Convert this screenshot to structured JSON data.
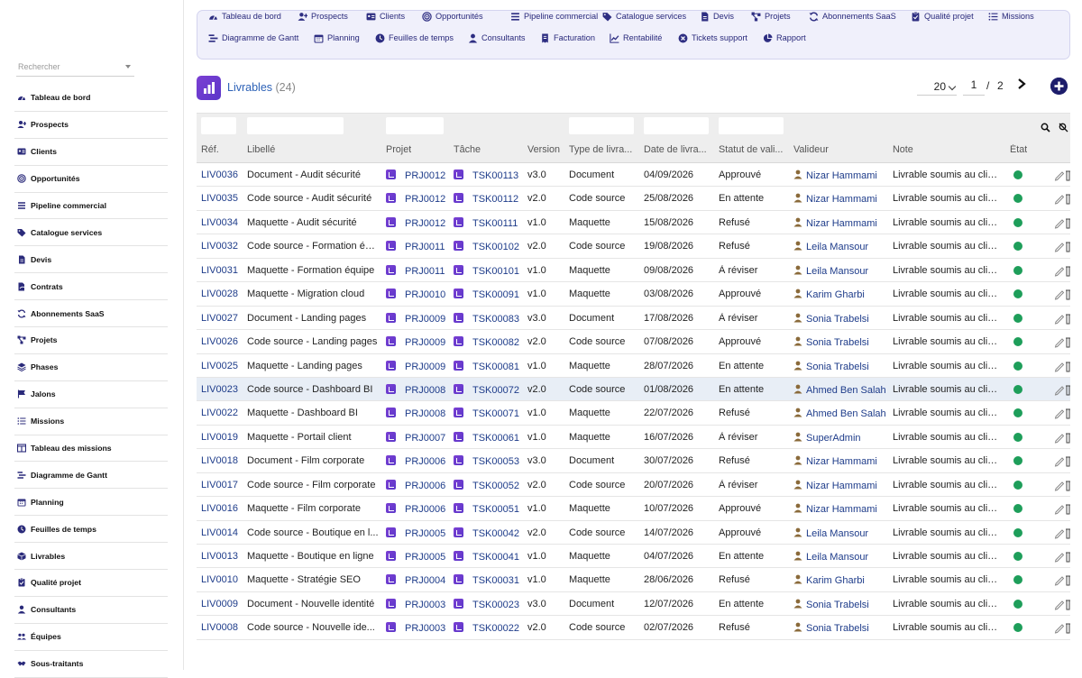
{
  "sidebar": {
    "search_placeholder": "Rechercher",
    "items": [
      {
        "label": "Tableau de bord",
        "icon": "dashboard-icon"
      },
      {
        "label": "Prospects",
        "icon": "user-plus-icon"
      },
      {
        "label": "Clients",
        "icon": "id-card-icon"
      },
      {
        "label": "Opportunités",
        "icon": "target-icon"
      },
      {
        "label": "Pipeline commercial",
        "icon": "bars-icon"
      },
      {
        "label": "Catalogue services",
        "icon": "tags-icon"
      },
      {
        "label": "Devis",
        "icon": "file-icon"
      },
      {
        "label": "Contrats",
        "icon": "file-signature-icon"
      },
      {
        "label": "Abonnements SaaS",
        "icon": "sync-icon"
      },
      {
        "label": "Projets",
        "icon": "project-diagram-icon"
      },
      {
        "label": "Phases",
        "icon": "layers-icon"
      },
      {
        "label": "Jalons",
        "icon": "flag-icon"
      },
      {
        "label": "Missions",
        "icon": "list-icon"
      },
      {
        "label": "Tableau des missions",
        "icon": "columns-icon"
      },
      {
        "label": "Diagramme de Gantt",
        "icon": "gantt-icon"
      },
      {
        "label": "Planning",
        "icon": "calendar-icon"
      },
      {
        "label": "Feuilles de temps",
        "icon": "clock-icon"
      },
      {
        "label": "Livrables",
        "icon": "box-icon"
      },
      {
        "label": "Qualité projet",
        "icon": "clipboard-check-icon"
      },
      {
        "label": "Consultants",
        "icon": "user-icon"
      },
      {
        "label": "Équipes",
        "icon": "users-icon"
      },
      {
        "label": "Sous-traitants",
        "icon": "handshake-icon"
      }
    ]
  },
  "topnav": {
    "row1": [
      {
        "label": "Tableau de bord",
        "icon": "dashboard-icon"
      },
      {
        "label": "Prospects",
        "icon": "user-plus-icon"
      },
      {
        "label": "Clients",
        "icon": "id-card-icon"
      },
      {
        "label": "Opportunités",
        "icon": "target-icon"
      },
      {
        "label": "Pipeline commercial",
        "icon": "bars-icon"
      },
      {
        "label": "Catalogue services",
        "icon": "tags-icon"
      },
      {
        "label": "Devis",
        "icon": "file-icon"
      },
      {
        "label": "Projets",
        "icon": "project-diagram-icon"
      },
      {
        "label": "Abonnements SaaS",
        "icon": "sync-icon"
      },
      {
        "label": "Qualité projet",
        "icon": "clipboard-check-icon"
      },
      {
        "label": "Missions",
        "icon": "list-icon"
      }
    ],
    "row2": [
      {
        "label": "Diagramme de Gantt",
        "icon": "gantt-icon"
      },
      {
        "label": "Planning",
        "icon": "calendar-icon"
      },
      {
        "label": "Feuilles de temps",
        "icon": "clock-icon"
      },
      {
        "label": "Consultants",
        "icon": "user-icon"
      },
      {
        "label": "Facturation",
        "icon": "invoice-icon"
      },
      {
        "label": "Rentabilité",
        "icon": "chart-line-icon"
      },
      {
        "label": "Tickets support",
        "icon": "ticket-icon"
      },
      {
        "label": "Rapport",
        "icon": "pie-chart-icon"
      }
    ]
  },
  "page": {
    "title": "Livrables",
    "count": "(24)",
    "page_size": "20",
    "current_page": "1",
    "separator": "/",
    "total_pages": "2"
  },
  "table": {
    "headers": [
      "Réf.",
      "Libellé",
      "Projet",
      "Tâche",
      "Version",
      "Type de livra...",
      "Date de livra...",
      "Statut de vali...",
      "Valideur",
      "Note",
      "État"
    ],
    "rows": [
      [
        "LIV0036",
        "Document - Audit sécurité",
        "PRJ0012",
        "TSK00113",
        "v3.0",
        "Document",
        "04/09/2026",
        "Approuvé",
        "Nizar Hammami",
        "Livrable soumis au client."
      ],
      [
        "LIV0035",
        "Code source - Audit sécurité",
        "PRJ0012",
        "TSK00112",
        "v2.0",
        "Code source",
        "25/08/2026",
        "En attente",
        "Nizar Hammami",
        "Livrable soumis au client."
      ],
      [
        "LIV0034",
        "Maquette - Audit sécurité",
        "PRJ0012",
        "TSK00111",
        "v1.0",
        "Maquette",
        "15/08/2026",
        "Refusé",
        "Nizar Hammami",
        "Livrable soumis au client."
      ],
      [
        "LIV0032",
        "Code source - Formation équ...",
        "PRJ0011",
        "TSK00102",
        "v2.0",
        "Code source",
        "19/08/2026",
        "Refusé",
        "Leila Mansour",
        "Livrable soumis au client."
      ],
      [
        "LIV0031",
        "Maquette - Formation équipe",
        "PRJ0011",
        "TSK00101",
        "v1.0",
        "Maquette",
        "09/08/2026",
        "À réviser",
        "Leila Mansour",
        "Livrable soumis au client."
      ],
      [
        "LIV0028",
        "Maquette - Migration cloud",
        "PRJ0010",
        "TSK00091",
        "v1.0",
        "Maquette",
        "03/08/2026",
        "Approuvé",
        "Karim Gharbi",
        "Livrable soumis au client."
      ],
      [
        "LIV0027",
        "Document - Landing pages",
        "PRJ0009",
        "TSK00083",
        "v3.0",
        "Document",
        "17/08/2026",
        "À réviser",
        "Sonia Trabelsi",
        "Livrable soumis au client."
      ],
      [
        "LIV0026",
        "Code source - Landing pages",
        "PRJ0009",
        "TSK00082",
        "v2.0",
        "Code source",
        "07/08/2026",
        "Approuvé",
        "Sonia Trabelsi",
        "Livrable soumis au client."
      ],
      [
        "LIV0025",
        "Maquette - Landing pages",
        "PRJ0009",
        "TSK00081",
        "v1.0",
        "Maquette",
        "28/07/2026",
        "En attente",
        "Sonia Trabelsi",
        "Livrable soumis au client."
      ],
      [
        "LIV0023",
        "Code source - Dashboard BI",
        "PRJ0008",
        "TSK00072",
        "v2.0",
        "Code source",
        "01/08/2026",
        "En attente",
        "Ahmed Ben Salah",
        "Livrable soumis au client."
      ],
      [
        "LIV0022",
        "Maquette - Dashboard BI",
        "PRJ0008",
        "TSK00071",
        "v1.0",
        "Maquette",
        "22/07/2026",
        "Refusé",
        "Ahmed Ben Salah",
        "Livrable soumis au client."
      ],
      [
        "LIV0019",
        "Maquette - Portail client",
        "PRJ0007",
        "TSK00061",
        "v1.0",
        "Maquette",
        "16/07/2026",
        "À réviser",
        "SuperAdmin",
        "Livrable soumis au client."
      ],
      [
        "LIV0018",
        "Document - Film corporate",
        "PRJ0006",
        "TSK00053",
        "v3.0",
        "Document",
        "30/07/2026",
        "Refusé",
        "Nizar Hammami",
        "Livrable soumis au client."
      ],
      [
        "LIV0017",
        "Code source - Film corporate",
        "PRJ0006",
        "TSK00052",
        "v2.0",
        "Code source",
        "20/07/2026",
        "À réviser",
        "Nizar Hammami",
        "Livrable soumis au client."
      ],
      [
        "LIV0016",
        "Maquette - Film corporate",
        "PRJ0006",
        "TSK00051",
        "v1.0",
        "Maquette",
        "10/07/2026",
        "Approuvé",
        "Nizar Hammami",
        "Livrable soumis au client."
      ],
      [
        "LIV0014",
        "Code source - Boutique en l...",
        "PRJ0005",
        "TSK00042",
        "v2.0",
        "Code source",
        "14/07/2026",
        "Approuvé",
        "Leila Mansour",
        "Livrable soumis au client."
      ],
      [
        "LIV0013",
        "Maquette - Boutique en ligne",
        "PRJ0005",
        "TSK00041",
        "v1.0",
        "Maquette",
        "04/07/2026",
        "En attente",
        "Leila Mansour",
        "Livrable soumis au client."
      ],
      [
        "LIV0010",
        "Maquette - Stratégie SEO",
        "PRJ0004",
        "TSK00031",
        "v1.0",
        "Maquette",
        "28/06/2026",
        "Refusé",
        "Karim Gharbi",
        "Livrable soumis au client."
      ],
      [
        "LIV0009",
        "Document - Nouvelle identité",
        "PRJ0003",
        "TSK00023",
        "v3.0",
        "Document",
        "12/07/2026",
        "En attente",
        "Sonia Trabelsi",
        "Livrable soumis au client."
      ],
      [
        "LIV0008",
        "Code source - Nouvelle ide...",
        "PRJ0003",
        "TSK00022",
        "v2.0",
        "Code source",
        "02/07/2026",
        "Refusé",
        "Sonia Trabelsi",
        "Livrable soumis au client."
      ]
    ],
    "highlight_row": 9
  },
  "colors": {
    "accent": "#1e3c8a",
    "status_ok": "#1e9e5a",
    "nav_bg": "#f0f0fb",
    "title_blue": "#2d62b7"
  }
}
